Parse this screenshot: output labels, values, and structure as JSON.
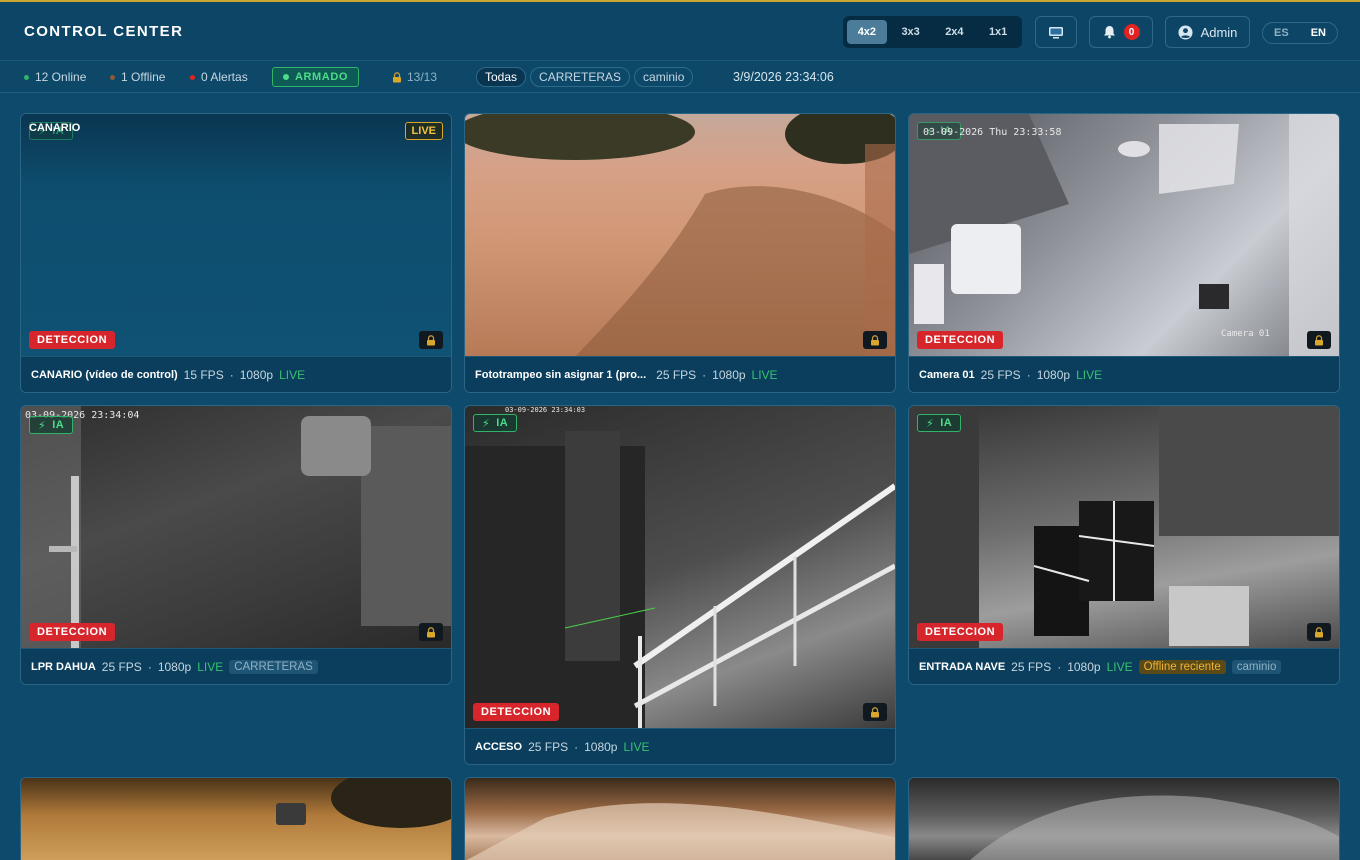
{
  "header": {
    "title": "CONTROL CENTER",
    "layouts": [
      "4x2",
      "3x3",
      "2x4",
      "1x1"
    ],
    "active_layout": "4x2",
    "notification_count": "0",
    "user_name": "Admin",
    "languages": [
      "ES",
      "EN"
    ],
    "active_language": "EN"
  },
  "status": {
    "online": "12 Online",
    "offline": "1 Offline",
    "alerts": "0 Alertas",
    "armed": "ARMADO",
    "locked_count": "13/13",
    "filters": [
      "Todas",
      "CARRETERAS",
      "caminio"
    ],
    "active_filter": "Todas",
    "datetime": "3/9/2026 23:34:06"
  },
  "colors": {
    "online_dot": "#2fb46a",
    "offline_dot": "#8a5a3c",
    "alert_dot": "#e02424",
    "accent": "#c9a531",
    "detection": "#d6262c"
  },
  "labels": {
    "detection": "DETECCION",
    "ia": "IA",
    "live": "LIVE",
    "overlay_live": "LIVE"
  },
  "cameras": [
    {
      "name": "CANARIO (vídeo de control)",
      "fps": "15 FPS",
      "res": "1080p",
      "status": "LIVE",
      "overlay_title": "CANARIO"
    },
    {
      "name": "Fototrampeo sin asignar 1 (pro...",
      "fps": "25 FPS",
      "res": "1080p",
      "status": "LIVE"
    },
    {
      "name": "Camera 01",
      "fps": "25 FPS",
      "res": "1080p",
      "status": "LIVE",
      "osd_time": "03-09-2026 Thu 23:33:58",
      "osd_label": "Camera 01"
    },
    {
      "name": "LPR DAHUA",
      "fps": "25 FPS",
      "res": "1080p",
      "status": "LIVE",
      "tag": "CARRETERAS",
      "osd_time": "03-09-2026 23:34:04"
    },
    {
      "name": "ACCESO",
      "fps": "25 FPS",
      "res": "1080p",
      "status": "LIVE",
      "osd_time": "03-09-2026 23:34:03"
    },
    {
      "name": "ENTRADA NAVE",
      "fps": "25 FPS",
      "res": "1080p",
      "status": "LIVE",
      "warn_tag": "Offline reciente",
      "tag": "caminio"
    }
  ]
}
